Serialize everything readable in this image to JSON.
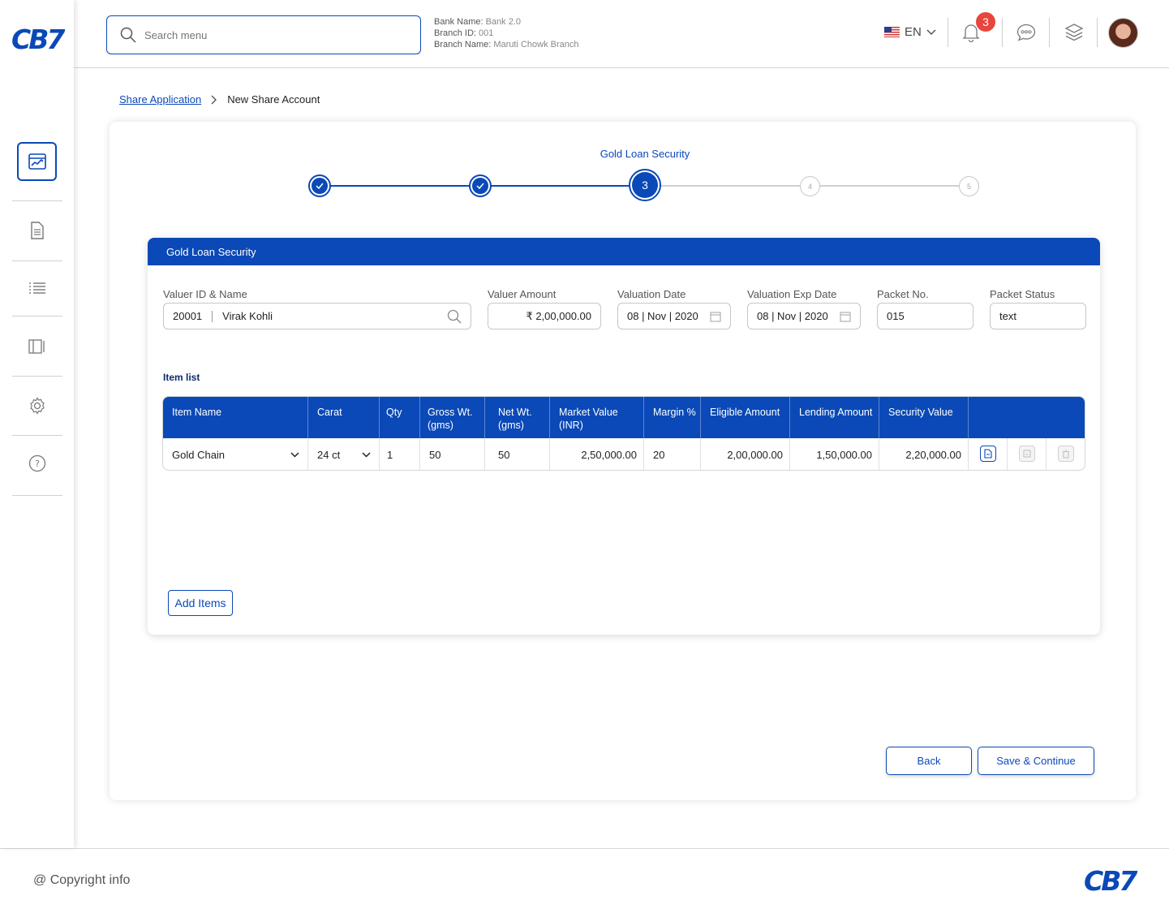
{
  "brand": {
    "logo_text": "CB7",
    "accent": "#0a49b7"
  },
  "header": {
    "search_placeholder": "Search menu",
    "bank_name_label": "Bank Name:",
    "bank_name": "Bank 2.0",
    "branch_id_label": "Branch ID:",
    "branch_id": "001",
    "branch_name_label": "Branch Name:",
    "branch_name": "Maruti Chowk Branch",
    "language": "EN",
    "notification_count": "3"
  },
  "breadcrumb": {
    "parent": "Share Application",
    "current": "New Share Account"
  },
  "stepper": {
    "title": "Gold Loan Security",
    "current_step": "3",
    "step4": "4",
    "step5": "5"
  },
  "section": {
    "title": "Gold Loan Security",
    "valuer_label": "Valuer ID & Name",
    "valuer_id": "20001",
    "valuer_name": "Virak Kohli",
    "valuer_amount_label": "Valuer Amount",
    "valuer_amount": "₹ 2,00,000.00",
    "valuation_date_label": "Valuation Date",
    "valuation_date": "08 | Nov | 2020",
    "valuation_exp_label": "Valuation Exp Date",
    "valuation_exp": "08 | Nov | 2020",
    "packet_no_label": "Packet No.",
    "packet_no": "015",
    "packet_status_label": "Packet Status",
    "packet_status": "text",
    "item_list_title": "Item list",
    "add_items": "Add Items"
  },
  "table": {
    "headers": [
      "Item Name",
      "Carat",
      "Qty",
      "Gross Wt. (gms)",
      "Net Wt. (gms)",
      "Market Value (INR)",
      "Margin %",
      "Eligible Amount",
      "Lending Amount",
      "Security Value"
    ],
    "row": {
      "item_name": "Gold Chain",
      "carat": "24 ct",
      "qty": "1",
      "gross_wt": "50",
      "net_wt": "50",
      "market_value": "2,50,000.00",
      "margin": "20",
      "eligible_amount": "2,00,000.00",
      "lending_amount": "1,50,000.00",
      "security_value": "2,20,000.00"
    }
  },
  "actions": {
    "back": "Back",
    "save_continue": "Save & Continue"
  },
  "footer": {
    "copyright": "@ Copyright info",
    "logo_text": "CB7"
  }
}
